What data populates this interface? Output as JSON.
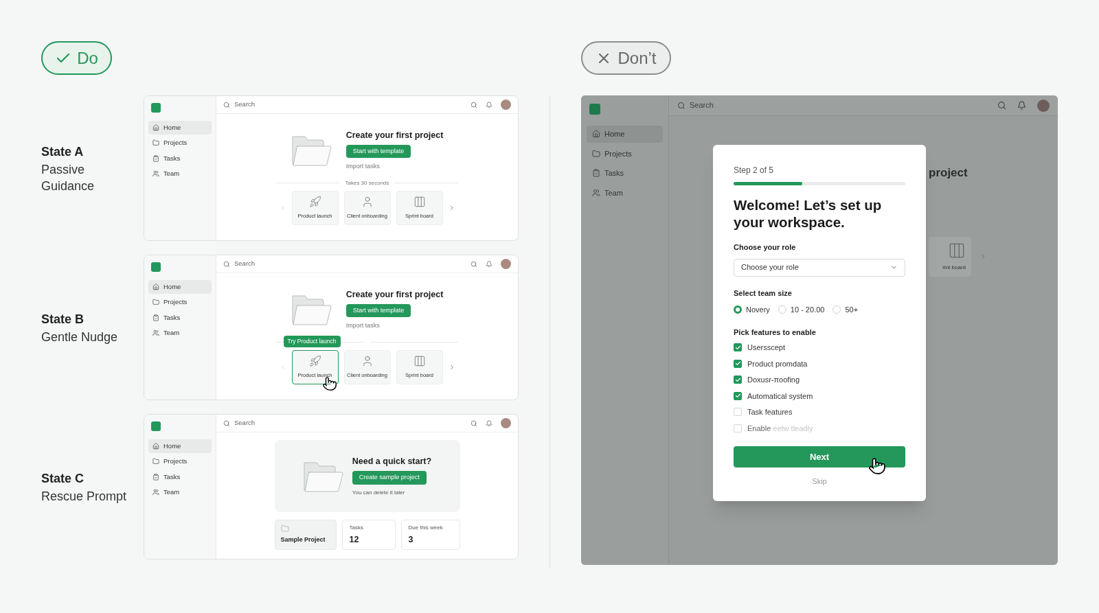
{
  "do_badge": {
    "label": "Do"
  },
  "dont_badge": {
    "label": "Don’t"
  },
  "states": [
    {
      "title": "State A",
      "subtitle": "Passive Guidance",
      "screen": {
        "kind": "templates",
        "search": {
          "placeholder": "Search"
        },
        "sidebar": [
          {
            "label": "Home",
            "selected": true
          },
          {
            "label": "Projects",
            "selected": false
          },
          {
            "label": "Tasks",
            "selected": false
          },
          {
            "label": "Team",
            "selected": false
          }
        ],
        "heading": "Create your first project",
        "primary_button": "Start with template",
        "link": "Import tasks",
        "divider_label": "Takes 30 seconds",
        "templates": [
          {
            "label": "Product launch",
            "selected": false
          },
          {
            "label": "Client onboarding",
            "selected": false
          },
          {
            "label": "Sprint board",
            "selected": false
          }
        ]
      }
    },
    {
      "title": "State B",
      "subtitle": "Gentle Nudge",
      "screen": {
        "kind": "templates",
        "search": {
          "placeholder": "Search"
        },
        "sidebar": [
          {
            "label": "Home",
            "selected": true
          },
          {
            "label": "Projects",
            "selected": false
          },
          {
            "label": "Tasks",
            "selected": false
          },
          {
            "label": "Team",
            "selected": false
          }
        ],
        "heading": "Create your first project",
        "primary_button": "Start with template",
        "link": "Import tasks",
        "tooltip": "Try Product launch",
        "templates": [
          {
            "label": "Product launch",
            "selected": true
          },
          {
            "label": "Client onboarding",
            "selected": false
          },
          {
            "label": "Sprint board",
            "selected": false
          }
        ]
      }
    },
    {
      "title": "State C",
      "subtitle": "Rescue Prompt",
      "screen": {
        "kind": "rescue",
        "search": {
          "placeholder": "Search"
        },
        "sidebar": [
          {
            "label": "Home",
            "selected": true
          },
          {
            "label": "Projects",
            "selected": false
          },
          {
            "label": "Tasks",
            "selected": false
          },
          {
            "label": "Team",
            "selected": false
          }
        ],
        "heading": "Need a quick start?",
        "primary_button": "Create sample project",
        "note": "You can delete it later",
        "cards": [
          {
            "kind": "project",
            "label": "Sample Project"
          },
          {
            "kind": "stat",
            "label": "Tasks",
            "value": "12"
          },
          {
            "kind": "stat",
            "label": "Due this week",
            "value": "3"
          }
        ]
      }
    }
  ],
  "dont_screen": {
    "search": {
      "placeholder": "Search"
    },
    "sidebar": [
      {
        "label": "Home",
        "selected": true
      },
      {
        "label": "Projects",
        "selected": false
      },
      {
        "label": "Tasks",
        "selected": false
      },
      {
        "label": "Team",
        "selected": false
      }
    ],
    "background_heading": "project",
    "background_card": "rint board",
    "modal": {
      "step": "Step 2 of 5",
      "progress": {
        "level": 0.4
      },
      "title": "Welcome! Let’s set up your workspace.",
      "role_label": "Choose your role",
      "role_select": {
        "placeholder": "Choose your role"
      },
      "team_size_label": "Select team size",
      "team_sizes": [
        {
          "label": "Novery",
          "selected": true
        },
        {
          "label": "10 - 20.00",
          "selected": false
        },
        {
          "label": "50+",
          "selected": false
        }
      ],
      "features_label": "Pick features to enable",
      "features": [
        {
          "label": "Usersscept",
          "checked": true
        },
        {
          "label": "Product promdata",
          "checked": true
        },
        {
          "label": "Doxusr-πoofing",
          "checked": true
        },
        {
          "label": "Automatical system",
          "checked": true
        },
        {
          "label": "Task features",
          "checked": false
        },
        {
          "label": "Enable",
          "faded_label": "eetw tleadly",
          "checked": false
        }
      ],
      "next_button": "Next",
      "skip_link": "Skip"
    }
  }
}
